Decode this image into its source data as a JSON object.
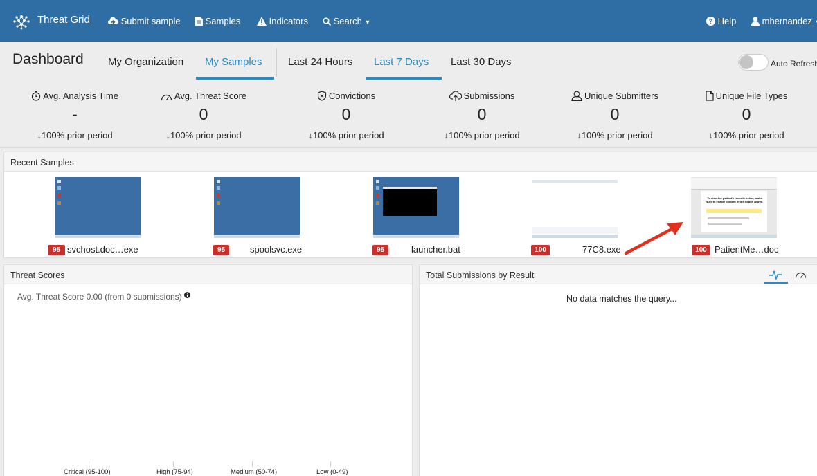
{
  "nav": {
    "brand": "Threat Grid",
    "submit": "Submit sample",
    "samples": "Samples",
    "indicators": "Indicators",
    "search": "Search",
    "help": "Help",
    "user": "mhernandez"
  },
  "header": {
    "title": "Dashboard",
    "tabs": [
      "My Organization",
      "My Samples"
    ],
    "ranges": [
      "Last 24 Hours",
      "Last 7 Days",
      "Last 30 Days"
    ],
    "auto_refresh": "Auto Refresh"
  },
  "stats": [
    {
      "label": "Avg. Analysis Time",
      "value": "-",
      "change": "100% prior period",
      "icon": "stopwatch-icon"
    },
    {
      "label": "Avg. Threat Score",
      "value": "0",
      "change": "100% prior period",
      "icon": "gauge-icon"
    },
    {
      "label": "Convictions",
      "value": "0",
      "change": "100% prior period",
      "icon": "shield-x-icon"
    },
    {
      "label": "Submissions",
      "value": "0",
      "change": "100% prior period",
      "icon": "cloud-upload-icon"
    },
    {
      "label": "Unique Submitters",
      "value": "0",
      "change": "100% prior period",
      "icon": "user-icon"
    },
    {
      "label": "Unique File Types",
      "value": "0",
      "change": "100% prior period",
      "icon": "file-icon"
    }
  ],
  "recent": {
    "title": "Recent Samples",
    "items": [
      {
        "score": "95",
        "name": "svchost.doc…exe"
      },
      {
        "score": "95",
        "name": "spoolsvc.exe"
      },
      {
        "score": "95",
        "name": "launcher.bat"
      },
      {
        "score": "100",
        "name": "77C8.exe"
      },
      {
        "score": "100",
        "name": "PatientMe…doc"
      }
    ],
    "doc_preview_text": "To view the patient's records below, make sure to enable content in the ribbon above."
  },
  "threat": {
    "title": "Threat Scores",
    "subtitle": "Avg. Threat Score 0.00 (from 0 submissions)",
    "categories": [
      "Critical (95-100)",
      "High (75-94)",
      "Medium (50-74)",
      "Low (0-49)"
    ]
  },
  "submissions": {
    "title": "Total Submissions by Result",
    "empty": "No data matches the query..."
  },
  "colors": {
    "nav_bg": "#2f6ea4",
    "accent": "#2a8bc2",
    "badge": "#c9302c",
    "arrow": "#e03020"
  }
}
